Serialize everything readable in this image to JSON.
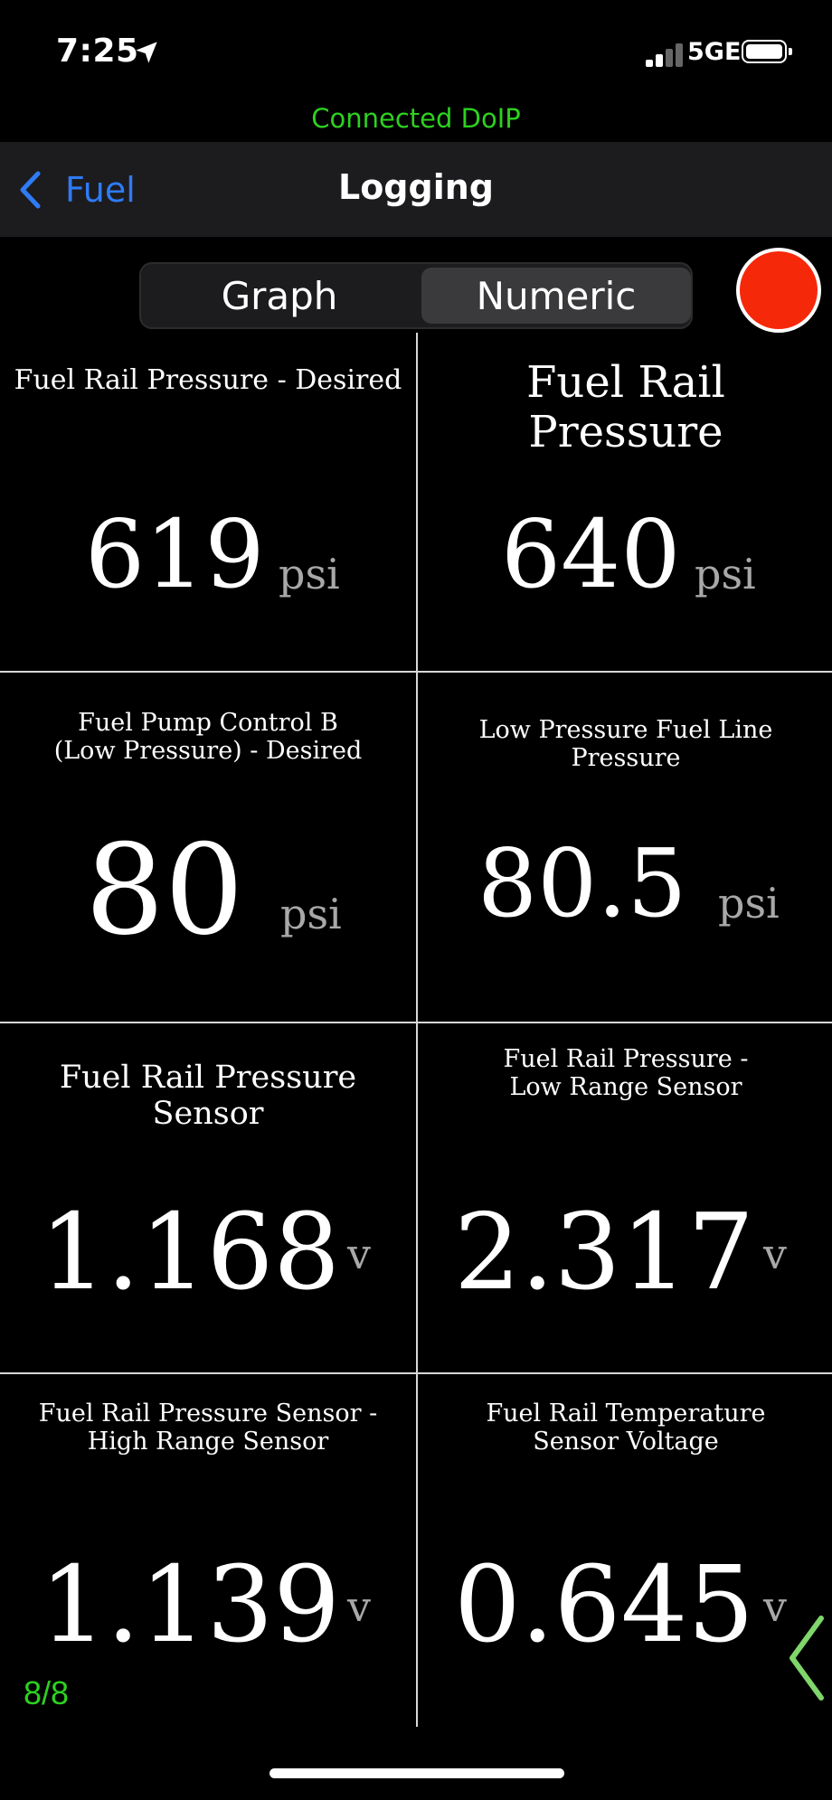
{
  "status_bar": {
    "time": "7:25",
    "network": "5GE"
  },
  "connection_status": "Connected DoIP",
  "nav": {
    "back_label": "Fuel",
    "title": "Logging"
  },
  "segmented": {
    "graph_label": "Graph",
    "numeric_label": "Numeric",
    "selected": "Numeric"
  },
  "tiles": [
    {
      "label": "Fuel Rail Pressure - Desired",
      "value": "619",
      "unit": "psi"
    },
    {
      "label": "Fuel Rail Pressure",
      "value": "640",
      "unit": "psi"
    },
    {
      "label": "Fuel Pump Control B (Low Pressure) - Desired",
      "value": "80",
      "unit": "psi"
    },
    {
      "label": "Low Pressure Fuel Line Pressure",
      "value": "80.5",
      "unit": "psi"
    },
    {
      "label": "Fuel Rail Pressure Sensor",
      "value": "1.168",
      "unit": "v"
    },
    {
      "label": "Fuel Rail Pressure - Low Range Sensor",
      "value": "2.317",
      "unit": "v"
    },
    {
      "label": "Fuel Rail Pressure Sensor - High Range Sensor",
      "value": "1.139",
      "unit": "v"
    },
    {
      "label": "Fuel Rail Temperature Sensor Voltage",
      "value": "0.645",
      "unit": "v"
    }
  ],
  "page_indicator": "8/8",
  "colors": {
    "accent_green": "#2dd11f",
    "link_blue": "#2f7bf5",
    "record_red": "#f6280a"
  },
  "icons": {
    "back": "chevron-left-icon",
    "location": "location-arrow-icon",
    "next": "chevron-left-icon"
  }
}
